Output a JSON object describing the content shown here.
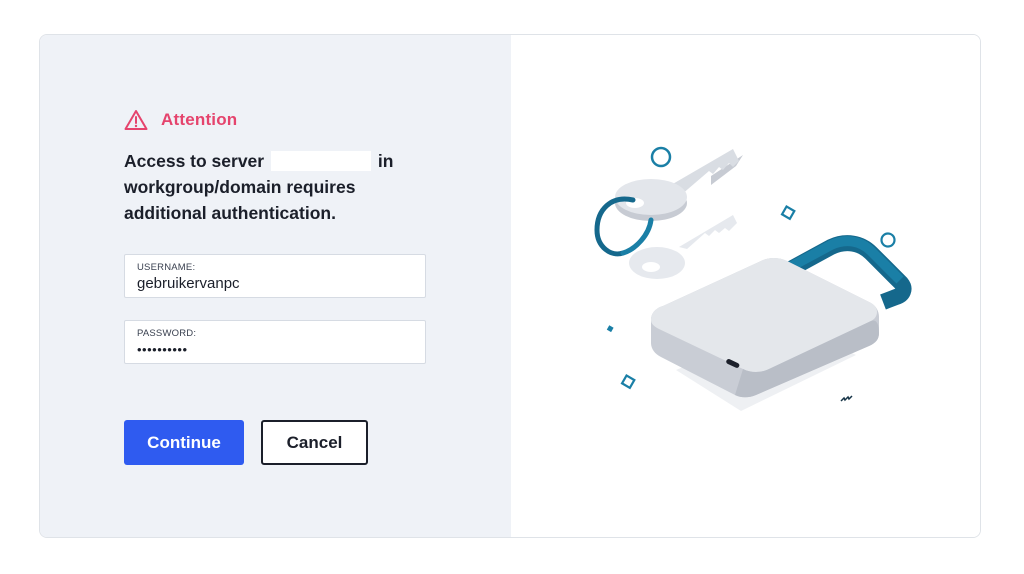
{
  "alert": {
    "title": "Attention",
    "icon": "warning-triangle-icon",
    "color": "#e5446d"
  },
  "message": {
    "part1": "Access to server",
    "part2": "in workgroup/domain requires additional authentication."
  },
  "form": {
    "username": {
      "label": "USERNAME:",
      "value": "gebruikervanpc"
    },
    "password": {
      "label": "PASSWORD:",
      "value": "••••••••••"
    }
  },
  "buttons": {
    "continue_label": "Continue",
    "cancel_label": "Cancel",
    "continue_color": "#2f5bf0"
  },
  "illustration": {
    "icon": "key-and-padlock-illustration",
    "accent": "#1a7fa6"
  }
}
